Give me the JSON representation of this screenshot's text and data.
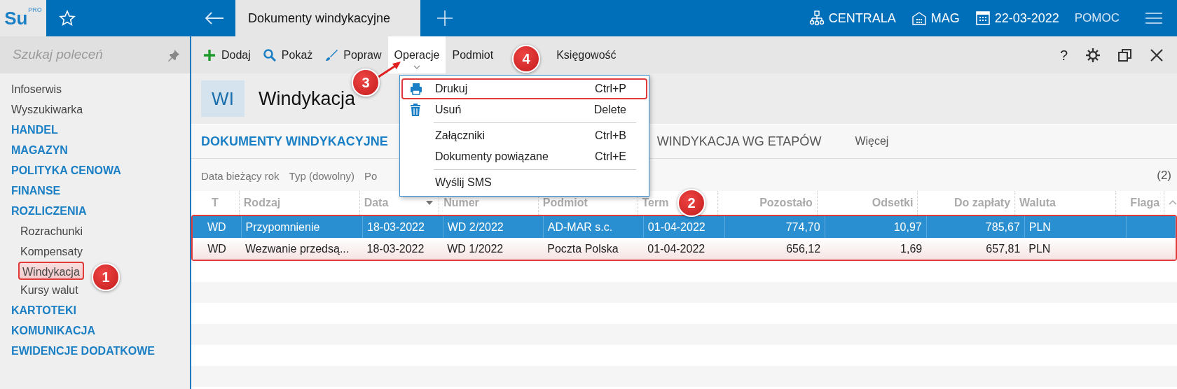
{
  "app": {
    "logo": "Su",
    "logo_superscript": "PRO"
  },
  "top_bar": {
    "tabs": [
      {
        "label": "Dokumenty windykacyjne",
        "selected": true
      }
    ],
    "context": [
      {
        "kind": "branch",
        "label": "CENTRALA"
      },
      {
        "kind": "warehouse",
        "label": "MAG"
      },
      {
        "kind": "date",
        "label": "22-03-2022"
      }
    ],
    "help": "POMOC"
  },
  "sidebar": {
    "search": {
      "placeholder": "Szukaj poleceń"
    },
    "items": [
      {
        "kind": "link",
        "label": "Infoserwis"
      },
      {
        "kind": "link",
        "label": "Wyszukiwarka"
      },
      {
        "kind": "group",
        "label": "HANDEL"
      },
      {
        "kind": "group",
        "label": "MAGAZYN"
      },
      {
        "kind": "group",
        "label": "POLITYKA CENOWA"
      },
      {
        "kind": "group",
        "label": "FINANSE"
      },
      {
        "kind": "group",
        "label": "ROZLICZENIA",
        "children": [
          {
            "label": "Rozrachunki",
            "selected": false
          },
          {
            "label": "Kompensaty",
            "selected": false
          },
          {
            "label": "Windykacja",
            "selected": true
          },
          {
            "label": "Kursy walut",
            "selected": false
          }
        ]
      },
      {
        "kind": "group",
        "label": "KARTOTEKI"
      },
      {
        "kind": "group",
        "label": "KOMUNIKACJA"
      },
      {
        "kind": "group",
        "label": "EWIDENCJE DODATKOWE"
      }
    ]
  },
  "toolbar": {
    "buttons": [
      {
        "kind": "add",
        "label": "Dodaj",
        "expanded": false
      },
      {
        "kind": "view",
        "label": "Pokaż",
        "expanded": false
      },
      {
        "kind": "edit",
        "label": "Popraw",
        "expanded": false
      },
      {
        "kind": "plain",
        "label": "Operacje",
        "expanded": true
      },
      {
        "kind": "plain",
        "label": "Podmiot",
        "expanded": false
      },
      {
        "kind": "plain",
        "label": "Księgowość",
        "expanded": false
      }
    ],
    "help": "?"
  },
  "header": {
    "badge": "WI",
    "title": "Windykacja"
  },
  "view_tabs": [
    {
      "label": "DOKUMENTY WINDYKACYJNE",
      "selected": true
    },
    {
      "label": "WINDYKACJA WG ETAPÓW",
      "selected": false
    },
    {
      "label": "Więcej",
      "selected": false
    }
  ],
  "filters": [
    {
      "label": "Data",
      "value": "bieżący rok"
    },
    {
      "label": "Typ (dowolny)"
    },
    {
      "label": "Po"
    }
  ],
  "count": "(2)",
  "table": {
    "highlighted": true,
    "columns": [
      {
        "label": "T",
        "kind": "code",
        "sorted": false
      },
      {
        "label": "Rodzaj",
        "kind": "text",
        "sorted": false
      },
      {
        "label": "Data",
        "kind": "text",
        "sorted": true
      },
      {
        "label": "Numer",
        "kind": "text",
        "sorted": false
      },
      {
        "label": "Podmiot",
        "kind": "text",
        "sorted": false
      },
      {
        "label": "Term",
        "kind": "text",
        "sorted": false
      },
      {
        "label": "Pozostało",
        "kind": "number",
        "sorted": false
      },
      {
        "label": "Odsetki",
        "kind": "number",
        "sorted": false
      },
      {
        "label": "Do zapłaty",
        "kind": "number",
        "sorted": false
      },
      {
        "label": "Waluta",
        "kind": "text",
        "sorted": false
      },
      {
        "label": "Flaga",
        "kind": "number",
        "sorted": false
      }
    ],
    "rows": [
      {
        "selected": true,
        "cells": [
          "WD",
          "Przypomnienie",
          "18-03-2022",
          "WD 2/2022",
          "AD-MAR s.c.",
          "01-04-2022",
          "774,70",
          "10,97",
          "785,67",
          "PLN",
          ""
        ]
      },
      {
        "selected": false,
        "cells": [
          "WD",
          "Wezwanie przedsą...",
          "18-03-2022",
          "WD 1/2022",
          "Poczta Polska",
          "01-04-2022",
          "656,12",
          "1,69",
          "657,81",
          "PLN",
          ""
        ]
      }
    ]
  },
  "menu": {
    "items": [
      {
        "kind": "print",
        "label": "Drukuj",
        "shortcut": "Ctrl+P",
        "highlighted": true
      },
      {
        "kind": "delete",
        "label": "Usuń",
        "shortcut": "Delete",
        "highlighted": false
      },
      {
        "kind": "separator"
      },
      {
        "kind": "plain",
        "label": "Załączniki",
        "shortcut": "Ctrl+B",
        "highlighted": false
      },
      {
        "kind": "plain",
        "label": "Dokumenty powiązane",
        "shortcut": "Ctrl+E",
        "highlighted": false
      },
      {
        "kind": "separator"
      },
      {
        "kind": "plain",
        "label": "Wyślij SMS",
        "highlighted": false
      }
    ]
  },
  "callouts": [
    {
      "number": "1",
      "kind": "badge"
    },
    {
      "number": "2",
      "kind": "badge"
    },
    {
      "number": "3",
      "kind": "arrow"
    },
    {
      "number": "4",
      "kind": "badge"
    }
  ]
}
